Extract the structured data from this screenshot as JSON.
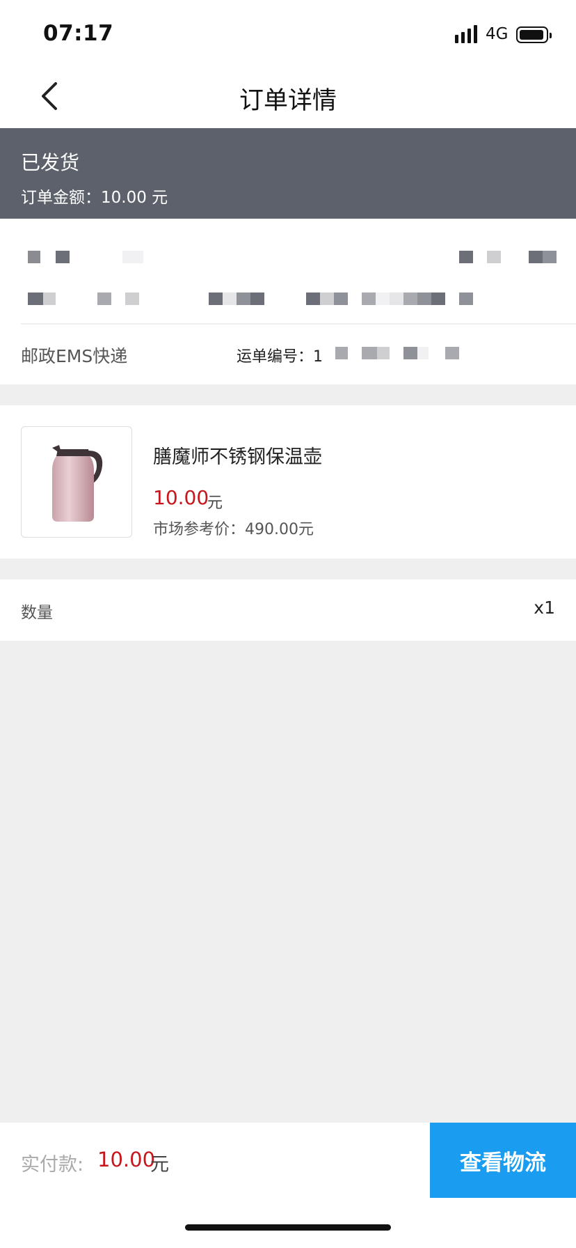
{
  "status_bar": {
    "time": "07:17",
    "network": "4G"
  },
  "nav": {
    "title": "订单详情",
    "back_icon": "chevron-left-icon"
  },
  "order_status": {
    "state": "已发货",
    "amount_text": "订单金额：10.00 元"
  },
  "shipping": {
    "carrier": "邮政EMS快递",
    "waybill_label": "运单编号：1"
  },
  "product": {
    "name": "膳魔师不锈钢保温壶",
    "price": "10.00",
    "unit": "元",
    "market_price": "市场参考价：490.00元"
  },
  "quantity": {
    "label": "数量",
    "value": "x1"
  },
  "payment": {
    "label": "实付款:",
    "amount": "10.00",
    "unit": "元"
  },
  "actions": {
    "logistics_label": "查看物流"
  },
  "colors": {
    "accent": "#1a9cf0",
    "price_red": "#c8161d",
    "status_band": "#5d616b",
    "page_bg": "#efefef"
  }
}
